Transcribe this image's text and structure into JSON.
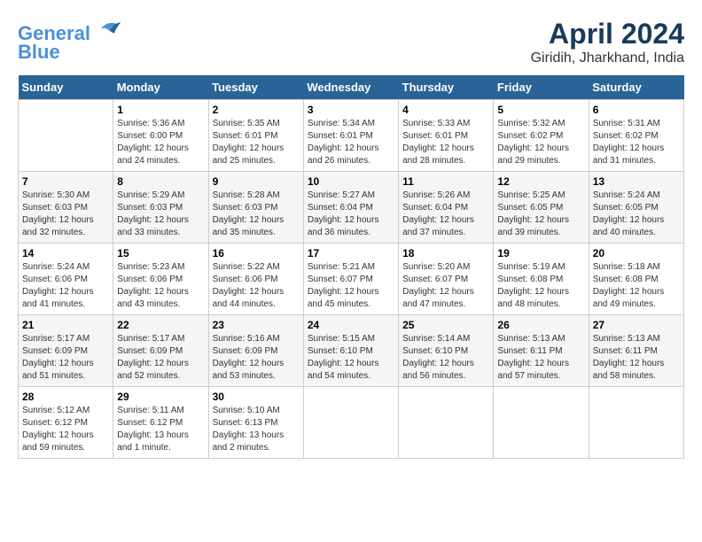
{
  "header": {
    "logo_line1": "General",
    "logo_line2": "Blue",
    "title": "April 2024",
    "subtitle": "Giridih, Jharkhand, India"
  },
  "calendar": {
    "days_of_week": [
      "Sunday",
      "Monday",
      "Tuesday",
      "Wednesday",
      "Thursday",
      "Friday",
      "Saturday"
    ],
    "weeks": [
      [
        {
          "day": "",
          "info": ""
        },
        {
          "day": "1",
          "info": "Sunrise: 5:36 AM\nSunset: 6:00 PM\nDaylight: 12 hours\nand 24 minutes."
        },
        {
          "day": "2",
          "info": "Sunrise: 5:35 AM\nSunset: 6:01 PM\nDaylight: 12 hours\nand 25 minutes."
        },
        {
          "day": "3",
          "info": "Sunrise: 5:34 AM\nSunset: 6:01 PM\nDaylight: 12 hours\nand 26 minutes."
        },
        {
          "day": "4",
          "info": "Sunrise: 5:33 AM\nSunset: 6:01 PM\nDaylight: 12 hours\nand 28 minutes."
        },
        {
          "day": "5",
          "info": "Sunrise: 5:32 AM\nSunset: 6:02 PM\nDaylight: 12 hours\nand 29 minutes."
        },
        {
          "day": "6",
          "info": "Sunrise: 5:31 AM\nSunset: 6:02 PM\nDaylight: 12 hours\nand 31 minutes."
        }
      ],
      [
        {
          "day": "7",
          "info": "Sunrise: 5:30 AM\nSunset: 6:03 PM\nDaylight: 12 hours\nand 32 minutes."
        },
        {
          "day": "8",
          "info": "Sunrise: 5:29 AM\nSunset: 6:03 PM\nDaylight: 12 hours\nand 33 minutes."
        },
        {
          "day": "9",
          "info": "Sunrise: 5:28 AM\nSunset: 6:03 PM\nDaylight: 12 hours\nand 35 minutes."
        },
        {
          "day": "10",
          "info": "Sunrise: 5:27 AM\nSunset: 6:04 PM\nDaylight: 12 hours\nand 36 minutes."
        },
        {
          "day": "11",
          "info": "Sunrise: 5:26 AM\nSunset: 6:04 PM\nDaylight: 12 hours\nand 37 minutes."
        },
        {
          "day": "12",
          "info": "Sunrise: 5:25 AM\nSunset: 6:05 PM\nDaylight: 12 hours\nand 39 minutes."
        },
        {
          "day": "13",
          "info": "Sunrise: 5:24 AM\nSunset: 6:05 PM\nDaylight: 12 hours\nand 40 minutes."
        }
      ],
      [
        {
          "day": "14",
          "info": "Sunrise: 5:24 AM\nSunset: 6:06 PM\nDaylight: 12 hours\nand 41 minutes."
        },
        {
          "day": "15",
          "info": "Sunrise: 5:23 AM\nSunset: 6:06 PM\nDaylight: 12 hours\nand 43 minutes."
        },
        {
          "day": "16",
          "info": "Sunrise: 5:22 AM\nSunset: 6:06 PM\nDaylight: 12 hours\nand 44 minutes."
        },
        {
          "day": "17",
          "info": "Sunrise: 5:21 AM\nSunset: 6:07 PM\nDaylight: 12 hours\nand 45 minutes."
        },
        {
          "day": "18",
          "info": "Sunrise: 5:20 AM\nSunset: 6:07 PM\nDaylight: 12 hours\nand 47 minutes."
        },
        {
          "day": "19",
          "info": "Sunrise: 5:19 AM\nSunset: 6:08 PM\nDaylight: 12 hours\nand 48 minutes."
        },
        {
          "day": "20",
          "info": "Sunrise: 5:18 AM\nSunset: 6:08 PM\nDaylight: 12 hours\nand 49 minutes."
        }
      ],
      [
        {
          "day": "21",
          "info": "Sunrise: 5:17 AM\nSunset: 6:09 PM\nDaylight: 12 hours\nand 51 minutes."
        },
        {
          "day": "22",
          "info": "Sunrise: 5:17 AM\nSunset: 6:09 PM\nDaylight: 12 hours\nand 52 minutes."
        },
        {
          "day": "23",
          "info": "Sunrise: 5:16 AM\nSunset: 6:09 PM\nDaylight: 12 hours\nand 53 minutes."
        },
        {
          "day": "24",
          "info": "Sunrise: 5:15 AM\nSunset: 6:10 PM\nDaylight: 12 hours\nand 54 minutes."
        },
        {
          "day": "25",
          "info": "Sunrise: 5:14 AM\nSunset: 6:10 PM\nDaylight: 12 hours\nand 56 minutes."
        },
        {
          "day": "26",
          "info": "Sunrise: 5:13 AM\nSunset: 6:11 PM\nDaylight: 12 hours\nand 57 minutes."
        },
        {
          "day": "27",
          "info": "Sunrise: 5:13 AM\nSunset: 6:11 PM\nDaylight: 12 hours\nand 58 minutes."
        }
      ],
      [
        {
          "day": "28",
          "info": "Sunrise: 5:12 AM\nSunset: 6:12 PM\nDaylight: 12 hours\nand 59 minutes."
        },
        {
          "day": "29",
          "info": "Sunrise: 5:11 AM\nSunset: 6:12 PM\nDaylight: 13 hours\nand 1 minute."
        },
        {
          "day": "30",
          "info": "Sunrise: 5:10 AM\nSunset: 6:13 PM\nDaylight: 13 hours\nand 2 minutes."
        },
        {
          "day": "",
          "info": ""
        },
        {
          "day": "",
          "info": ""
        },
        {
          "day": "",
          "info": ""
        },
        {
          "day": "",
          "info": ""
        }
      ]
    ]
  }
}
